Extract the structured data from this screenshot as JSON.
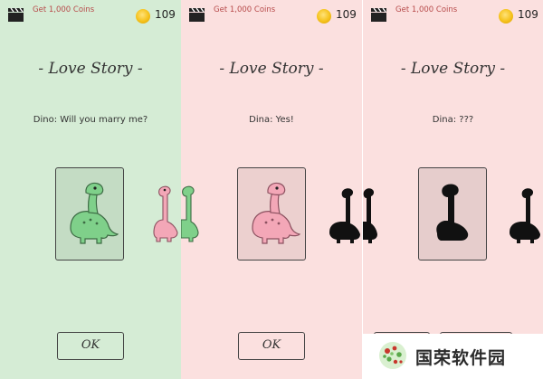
{
  "colors": {
    "panel1_bg": "#d5ecd5",
    "panel2_bg": "#fbe0df",
    "panel3_bg": "#fbe0df",
    "card1_bg": "#c4dcc4",
    "card2_bg": "#ecd0cf",
    "card3_bg": "#e6cdcc",
    "green_dino": "#7fd08a",
    "pink_dino": "#f3a7b7",
    "silhouette": "#111111"
  },
  "panels": [
    {
      "get_coins": "Get 1,000 Coins",
      "coins": "109",
      "title": "- Love Story -",
      "dialog": "Dino: Will you marry me?",
      "ok_label": "OK"
    },
    {
      "get_coins": "Get 1,000 Coins",
      "coins": "109",
      "title": "- Love Story -",
      "dialog": "Dina: Yes!",
      "ok_label": "OK"
    },
    {
      "get_coins": "Get 1,000 Coins",
      "coins": "109",
      "title": "- Love Story -",
      "dialog": "Dina: ???"
    }
  ],
  "watermark": {
    "text": "国荣软件园"
  }
}
